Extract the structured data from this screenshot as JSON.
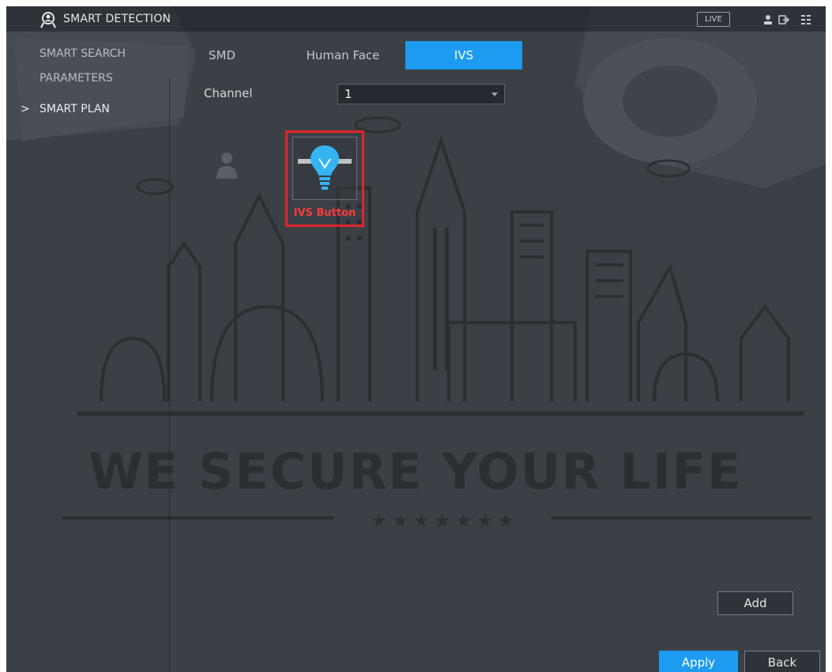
{
  "header": {
    "title": "SMART DETECTION",
    "app_icon": "smart-detection-icon",
    "live_label": "LIVE",
    "right_icons": [
      "user-icon",
      "exit-icon",
      "menu-grid-icon"
    ]
  },
  "sidebar": {
    "items": [
      {
        "label": "SMART SEARCH",
        "active": false
      },
      {
        "label": "PARAMETERS",
        "active": false
      },
      {
        "label": "SMART PLAN",
        "active": true
      }
    ],
    "chevron": ">"
  },
  "tabs": [
    {
      "label": "SMD",
      "active": false
    },
    {
      "label": "Human Face",
      "active": false
    },
    {
      "label": "IVS",
      "active": true
    }
  ],
  "channel": {
    "label": "Channel",
    "value": "1"
  },
  "plan_buttons": {
    "face_icon": "person-icon",
    "ivs_icon": "lightbulb-icon",
    "ivs_caption": "IVS Button"
  },
  "background_slogan": "WE SECURE YOUR LIFE",
  "actions": {
    "add": "Add",
    "apply": "Apply",
    "back": "Back"
  },
  "colors": {
    "accent": "#1d9bf0",
    "panel": "#3b3f46",
    "highlight": "#e0242c"
  }
}
